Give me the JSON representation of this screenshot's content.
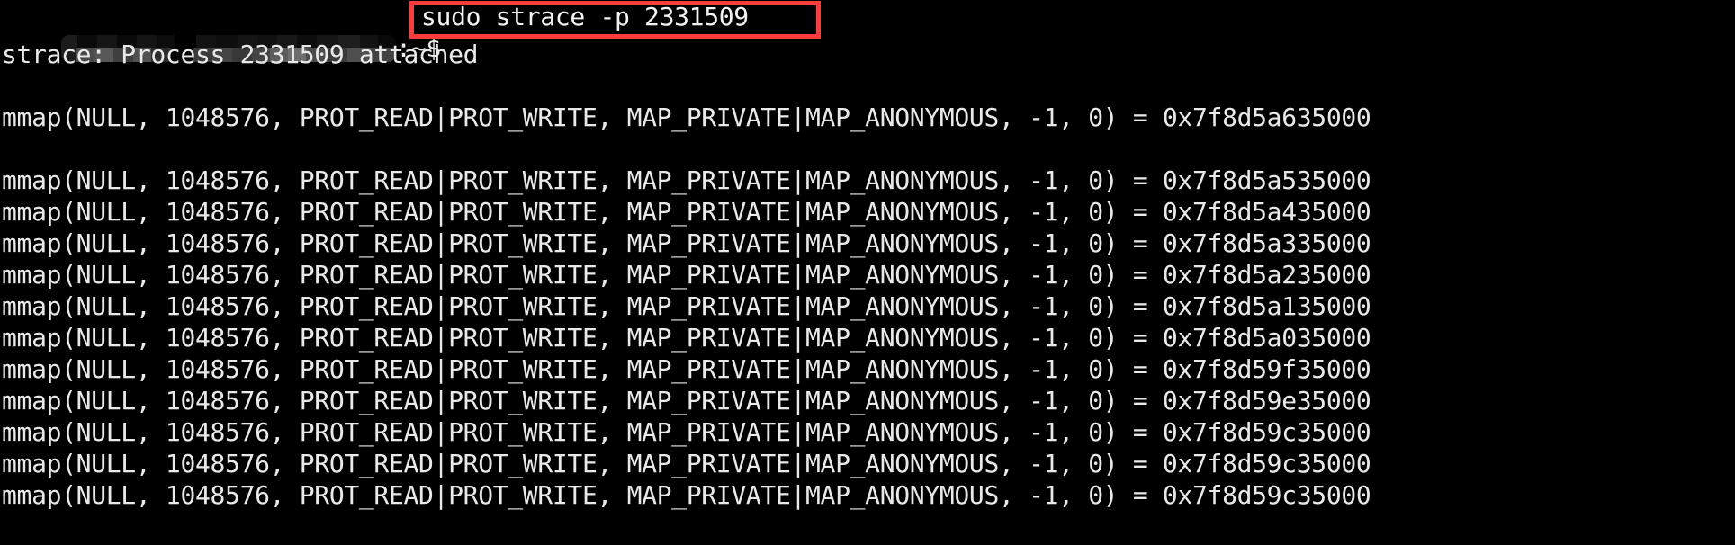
{
  "terminal": {
    "background_color": "#000000",
    "foreground_color": "#e9e9e9",
    "highlight_color": "#fa3c3c",
    "prompt": {
      "redacted_user_host": "",
      "suffix": ":~$",
      "command": "sudo strace -p 2331509"
    },
    "lines": [
      {
        "id": "attached",
        "text": "strace: Process 2331509 attached"
      },
      {
        "id": "blank1",
        "text": ""
      },
      {
        "id": "mmap1",
        "text": "mmap(NULL, 1048576, PROT_READ|PROT_WRITE, MAP_PRIVATE|MAP_ANONYMOUS, -1, 0) = 0x7f8d5a635000"
      },
      {
        "id": "blank2",
        "text": ""
      },
      {
        "id": "mmap2",
        "text": "mmap(NULL, 1048576, PROT_READ|PROT_WRITE, MAP_PRIVATE|MAP_ANONYMOUS, -1, 0) = 0x7f8d5a535000"
      },
      {
        "id": "mmap3",
        "text": "mmap(NULL, 1048576, PROT_READ|PROT_WRITE, MAP_PRIVATE|MAP_ANONYMOUS, -1, 0) = 0x7f8d5a435000"
      },
      {
        "id": "mmap4",
        "text": "mmap(NULL, 1048576, PROT_READ|PROT_WRITE, MAP_PRIVATE|MAP_ANONYMOUS, -1, 0) = 0x7f8d5a335000"
      },
      {
        "id": "mmap5",
        "text": "mmap(NULL, 1048576, PROT_READ|PROT_WRITE, MAP_PRIVATE|MAP_ANONYMOUS, -1, 0) = 0x7f8d5a235000"
      },
      {
        "id": "mmap6",
        "text": "mmap(NULL, 1048576, PROT_READ|PROT_WRITE, MAP_PRIVATE|MAP_ANONYMOUS, -1, 0) = 0x7f8d5a135000"
      },
      {
        "id": "mmap7",
        "text": "mmap(NULL, 1048576, PROT_READ|PROT_WRITE, MAP_PRIVATE|MAP_ANONYMOUS, -1, 0) = 0x7f8d5a035000"
      },
      {
        "id": "mmap8",
        "text": "mmap(NULL, 1048576, PROT_READ|PROT_WRITE, MAP_PRIVATE|MAP_ANONYMOUS, -1, 0) = 0x7f8d59f35000"
      },
      {
        "id": "mmap9",
        "text": "mmap(NULL, 1048576, PROT_READ|PROT_WRITE, MAP_PRIVATE|MAP_ANONYMOUS, -1, 0) = 0x7f8d59e35000"
      },
      {
        "id": "mmap10",
        "text": "mmap(NULL, 1048576, PROT_READ|PROT_WRITE, MAP_PRIVATE|MAP_ANONYMOUS, -1, 0) = 0x7f8d59c35000"
      }
    ]
  }
}
